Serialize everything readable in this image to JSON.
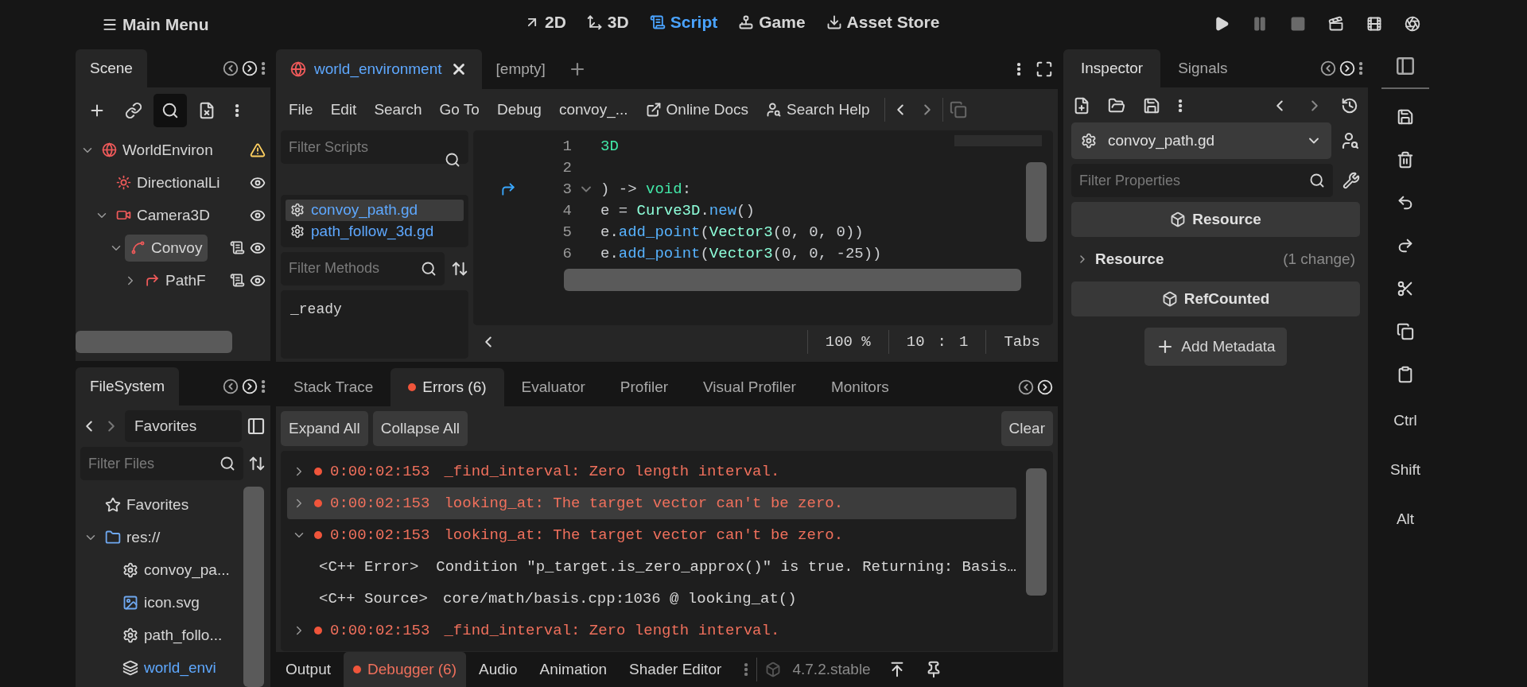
{
  "main_menu": {
    "label": "Main Menu"
  },
  "workspaces": [
    {
      "label": "2D",
      "kind": "flat",
      "selected": false
    },
    {
      "label": "3D",
      "kind": "spatial",
      "selected": false
    },
    {
      "label": "Script",
      "kind": "script",
      "selected": true
    },
    {
      "label": "Game",
      "kind": "game",
      "selected": false
    },
    {
      "label": "Asset Store",
      "kind": "store",
      "selected": false
    }
  ],
  "run_buttons": [
    {
      "kind": "play",
      "disabled": false
    },
    {
      "kind": "pause",
      "disabled": true
    },
    {
      "kind": "stop",
      "disabled": true
    },
    {
      "kind": "run_current",
      "disabled": false
    },
    {
      "kind": "run_custom",
      "disabled": false
    },
    {
      "kind": "movie",
      "disabled": false
    }
  ],
  "scene_dock": {
    "tabs": [
      {
        "label": "Scene",
        "selected": true
      }
    ],
    "toolbar": [
      {
        "kind": "add",
        "on": false
      },
      {
        "kind": "link",
        "on": false
      },
      {
        "kind": "search",
        "on": true
      },
      {
        "kind": "detach",
        "on": false
      },
      {
        "kind": "more",
        "on": false
      }
    ],
    "tree": [
      {
        "name": "WorldEnviron",
        "kind": "globe",
        "expanded": true,
        "selected": false,
        "warning": true,
        "children": [
          {
            "name": "DirectionalLi",
            "kind": "light",
            "selected": false,
            "visible": true
          },
          {
            "name": "Camera3D",
            "kind": "camera",
            "expanded": true,
            "selected": false,
            "visible": true,
            "children": [
              {
                "name": "Convoy",
                "kind": "path",
                "expanded": true,
                "selected": true,
                "script": true,
                "visible": true,
                "children": [
                  {
                    "name": "PathF",
                    "kind": "follow",
                    "expanded": false,
                    "selected": false,
                    "script": true,
                    "visible": true
                  }
                ]
              }
            ]
          }
        ]
      }
    ]
  },
  "filesystem": {
    "tabs": [
      {
        "label": "FileSystem",
        "selected": true
      }
    ],
    "path": "Favorites",
    "filter_placeholder": "Filter Files",
    "items": [
      {
        "name": "Favorites",
        "kind": "star"
      },
      {
        "name": "res://",
        "kind": "folder",
        "expanded": true,
        "children": [
          {
            "name": "convoy_pa...",
            "kind": "gear"
          },
          {
            "name": "icon.svg",
            "kind": "image"
          },
          {
            "name": "path_follo...",
            "kind": "gear"
          },
          {
            "name": "world_envi",
            "kind": "scene"
          }
        ]
      }
    ]
  },
  "script_editor": {
    "tabs": [
      {
        "label": "world_environment",
        "selected": true,
        "closable": true
      },
      {
        "label": "[empty]",
        "selected": false,
        "closable": false
      }
    ],
    "menus": [
      "File",
      "Edit",
      "Search",
      "Go To",
      "Debug",
      "convoy_..."
    ],
    "links": [
      {
        "label": "Online Docs",
        "kind": "external"
      },
      {
        "label": "Search Help",
        "kind": "doc"
      }
    ],
    "filter_scripts_placeholder": "Filter Scripts",
    "scripts": [
      {
        "name": "convoy_path.gd",
        "selected": true
      },
      {
        "name": "path_follow_3d.gd",
        "selected": false
      }
    ],
    "filter_methods_placeholder": "Filter Methods",
    "methods": [
      "_ready"
    ],
    "code": [
      {
        "number": "1",
        "tokens": [
          {
            "text": "3D",
            "kind": "keyword"
          }
        ]
      },
      {
        "number": "2"
      },
      {
        "number": "3",
        "override": true,
        "fold": true,
        "tokens": [
          {
            "text": ") -> ",
            "kind": "plain"
          },
          {
            "text": "void",
            "kind": "keyword"
          },
          {
            "text": ":",
            "kind": "plain"
          }
        ]
      },
      {
        "number": "4",
        "tokens": [
          {
            "text": "e = ",
            "kind": "plain"
          },
          {
            "text": "Curve3D",
            "kind": "type"
          },
          {
            "text": ".",
            "kind": "plain"
          },
          {
            "text": "new",
            "kind": "func"
          },
          {
            "text": "()",
            "kind": "plain"
          }
        ]
      },
      {
        "number": "5",
        "tokens": [
          {
            "text": "e.",
            "kind": "plain"
          },
          {
            "text": "add_point",
            "kind": "func"
          },
          {
            "text": "(",
            "kind": "plain"
          },
          {
            "text": "Vector3",
            "kind": "type"
          },
          {
            "text": "(0, 0, 0))",
            "kind": "plain"
          }
        ]
      },
      {
        "number": "6",
        "tokens": [
          {
            "text": "e.",
            "kind": "plain"
          },
          {
            "text": "add_point",
            "kind": "func"
          },
          {
            "text": "(",
            "kind": "plain"
          },
          {
            "text": "Vector3",
            "kind": "type"
          },
          {
            "text": "(0, 0, -25))",
            "kind": "plain"
          }
        ]
      }
    ],
    "status": {
      "zoom": "100 %",
      "line": "10",
      "separator": ":",
      "column": "1",
      "indent": "Tabs"
    }
  },
  "debugger": {
    "tabs": [
      {
        "label": "Stack Trace",
        "selected": false,
        "alert": false
      },
      {
        "label": "Errors (6)",
        "selected": true,
        "alert": true
      },
      {
        "label": "Evaluator",
        "selected": false,
        "alert": false
      },
      {
        "label": "Profiler",
        "selected": false,
        "alert": false
      },
      {
        "label": "Visual Profiler",
        "selected": false,
        "alert": false
      },
      {
        "label": "Monitors",
        "selected": false,
        "alert": false
      }
    ],
    "buttons": [
      "Expand All",
      "Collapse All"
    ],
    "clear_button": "Clear",
    "errors": [
      {
        "time": "0:00:02:153",
        "message": "_find_interval: Zero length interval.",
        "expanded": false,
        "selected": false
      },
      {
        "time": "0:00:02:153",
        "message": "looking_at: The target vector can't be zero.",
        "expanded": false,
        "selected": true
      },
      {
        "time": "0:00:02:153",
        "message": "looking_at: The target vector can't be zero.",
        "expanded": true,
        "selected": false,
        "details": [
          {
            "label": "<C++ Error>",
            "text": "Condition \"p_target.is_zero_approx()\" is true. Returning: Basis…"
          },
          {
            "label": "<C++ Source>",
            "text": "core/math/basis.cpp:1036 @ looking_at()"
          }
        ]
      },
      {
        "time": "0:00:02:153",
        "message": "_find_interval: Zero length interval.",
        "expanded": false,
        "selected": false
      }
    ]
  },
  "bottom_panel": {
    "tabs": [
      {
        "label": "Output",
        "selected": false,
        "alert": false
      },
      {
        "label": "Debugger (6)",
        "selected": true,
        "alert": true
      },
      {
        "label": "Audio",
        "selected": false,
        "alert": false
      },
      {
        "label": "Animation",
        "selected": false,
        "alert": false
      },
      {
        "label": "Shader Editor",
        "selected": false,
        "alert": false
      }
    ],
    "version": "4.7.2.stable"
  },
  "inspector": {
    "tabs": [
      {
        "label": "Inspector",
        "selected": true
      },
      {
        "label": "Signals",
        "selected": false
      }
    ],
    "resource": "convoy_path.gd",
    "filter_placeholder": "Filter Properties",
    "sections": [
      {
        "kind": "category",
        "label": "Resource"
      },
      {
        "kind": "group",
        "label": "Resource",
        "note": "(1 change)",
        "expanded": false
      },
      {
        "kind": "category",
        "label": "RefCounted"
      }
    ],
    "add_button": "Add Metadata"
  },
  "side_toolbar": {
    "keys": [
      "Ctrl",
      "Shift",
      "Alt"
    ]
  }
}
